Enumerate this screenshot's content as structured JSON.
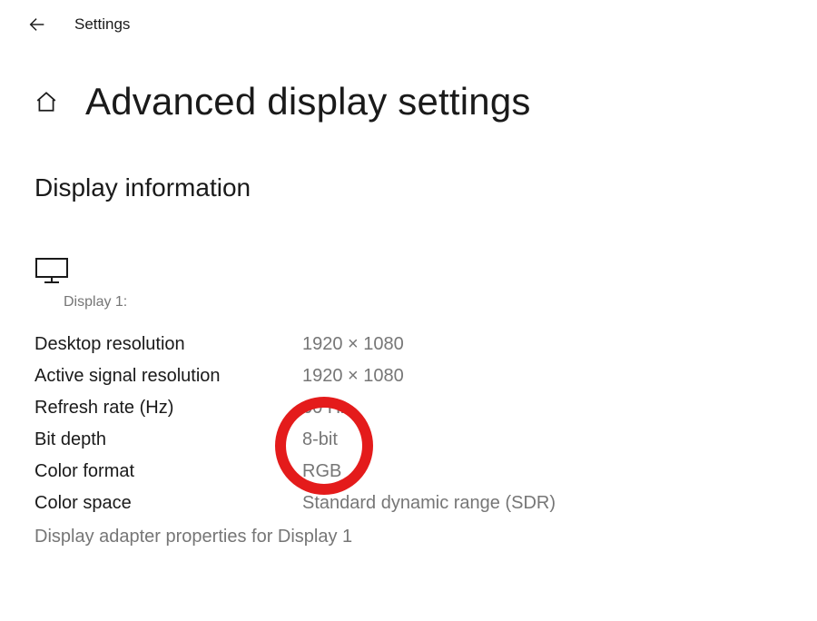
{
  "header": {
    "settings_label": "Settings"
  },
  "page": {
    "title": "Advanced display settings"
  },
  "section": {
    "title": "Display information"
  },
  "display": {
    "label": "Display 1:"
  },
  "info": {
    "rows": [
      {
        "label": "Desktop resolution",
        "value": "1920 × 1080"
      },
      {
        "label": "Active signal resolution",
        "value": "1920 × 1080"
      },
      {
        "label": "Refresh rate (Hz)",
        "value": "60 Hz"
      },
      {
        "label": "Bit depth",
        "value": "8-bit"
      },
      {
        "label": "Color format",
        "value": "RGB"
      },
      {
        "label": "Color space",
        "value": "Standard dynamic range (SDR)"
      }
    ]
  },
  "adapter_link": "Display adapter properties for Display 1"
}
